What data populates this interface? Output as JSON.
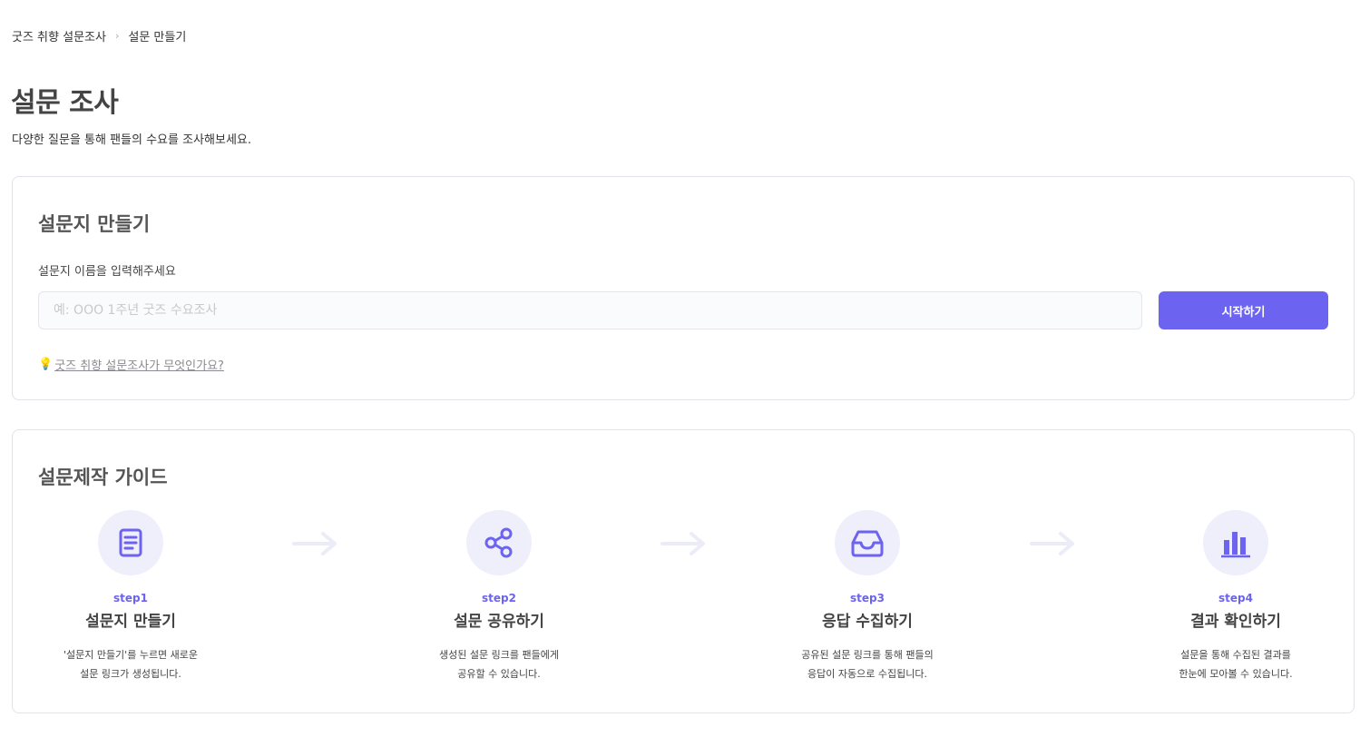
{
  "breadcrumb": {
    "parent": "굿즈 취향 설문조사",
    "current": "설문 만들기"
  },
  "page": {
    "title": "설문 조사",
    "subtitle": "다양한 질문을 통해 팬들의 수요를 조사해보세요."
  },
  "create": {
    "title": "설문지 만들기",
    "label": "설문지 이름을 입력해주세요",
    "placeholder": "예: OOO 1주년 굿즈 수요조사",
    "value": "",
    "button": "시작하기",
    "help_link": "굿즈 취향 설문조사가 무엇인가요?"
  },
  "guide": {
    "title": "설문제작 가이드",
    "steps": [
      {
        "num": "step1",
        "title": "설문지 만들기",
        "desc1": "'설문지 만들기'를 누르면 새로운",
        "desc2": "설문 링크가 생성됩니다.",
        "icon": "document-icon"
      },
      {
        "num": "step2",
        "title": "설문 공유하기",
        "desc1": "생성된 설문 링크를 팬들에게",
        "desc2": "공유할 수 있습니다.",
        "icon": "share-icon"
      },
      {
        "num": "step3",
        "title": "응답 수집하기",
        "desc1": "공유된 설문 링크를 통해 팬들의",
        "desc2": "응답이 자동으로 수집됩니다.",
        "icon": "inbox-icon"
      },
      {
        "num": "step4",
        "title": "결과 확인하기",
        "desc1": "설문을 통해 수집된 결과를",
        "desc2": "한눈에 모아볼 수 있습니다.",
        "icon": "bar-chart-icon"
      }
    ]
  },
  "colors": {
    "accent": "#6c63f0",
    "icon_bg": "#efeefb",
    "arrow": "#ecebf8"
  }
}
